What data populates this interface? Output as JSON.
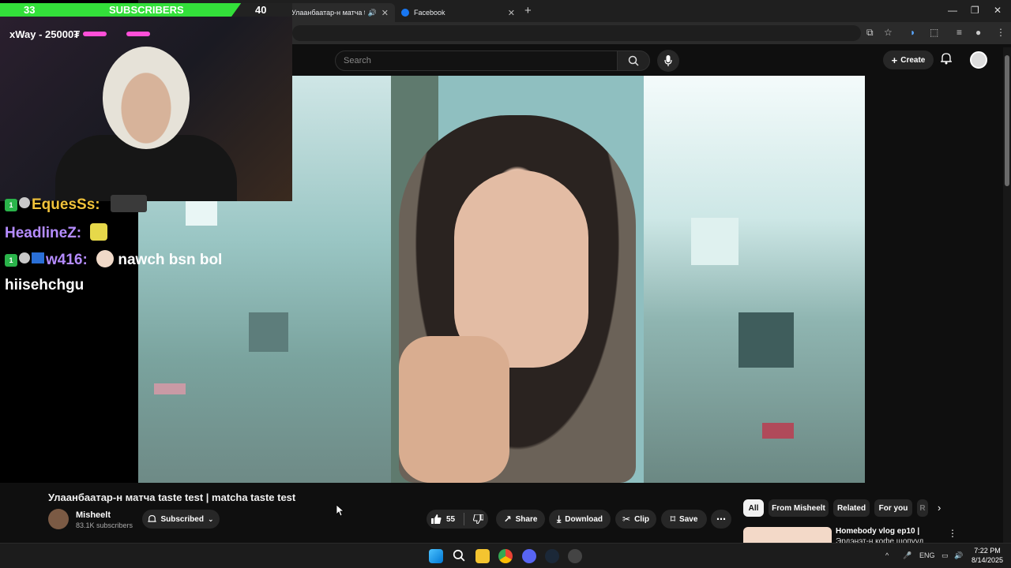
{
  "overlay": {
    "subs_current": "33",
    "subs_label": "SUBSCRIBERS",
    "subs_goal": "40",
    "subs_progress": 0.825,
    "donor_text": "xWay - 25000₮",
    "chat": [
      {
        "user": "EquesSs:",
        "color": "#f0c23a",
        "message": ""
      },
      {
        "user": "HeadlineZ:",
        "color": "#b58cff",
        "message": ""
      },
      {
        "user": "w416:",
        "color": "#b58cff",
        "message": "nawch bsn bol"
      },
      {
        "user": "hiisehchgu",
        "color": "#ffffff",
        "message": ""
      }
    ]
  },
  "browser": {
    "tabs": [
      {
        "label": "Улаанбаатар-н матча taste",
        "active": true
      },
      {
        "label": "Facebook",
        "active": false
      }
    ]
  },
  "youtube": {
    "search_placeholder": "Search",
    "create_label": "Create",
    "video_title": "Улаанбаатар-н матча taste test | matcha taste test",
    "channel_name": "Misheelt",
    "channel_subs": "83.1K subscribers",
    "subscribed_label": "Subscribed",
    "likes": "55",
    "share_label": "Share",
    "download_label": "Download",
    "clip_label": "Clip",
    "save_label": "Save",
    "chips": [
      "All",
      "From Misheelt",
      "Related",
      "For you",
      "R"
    ],
    "recommended": {
      "title": "Homebody vlog ep10 |",
      "subtitle": "Эрдэнэт-н кофе шопууд"
    }
  },
  "taskbar": {
    "lang": "ENG",
    "time": "7:22 PM",
    "date": "8/14/2025"
  }
}
